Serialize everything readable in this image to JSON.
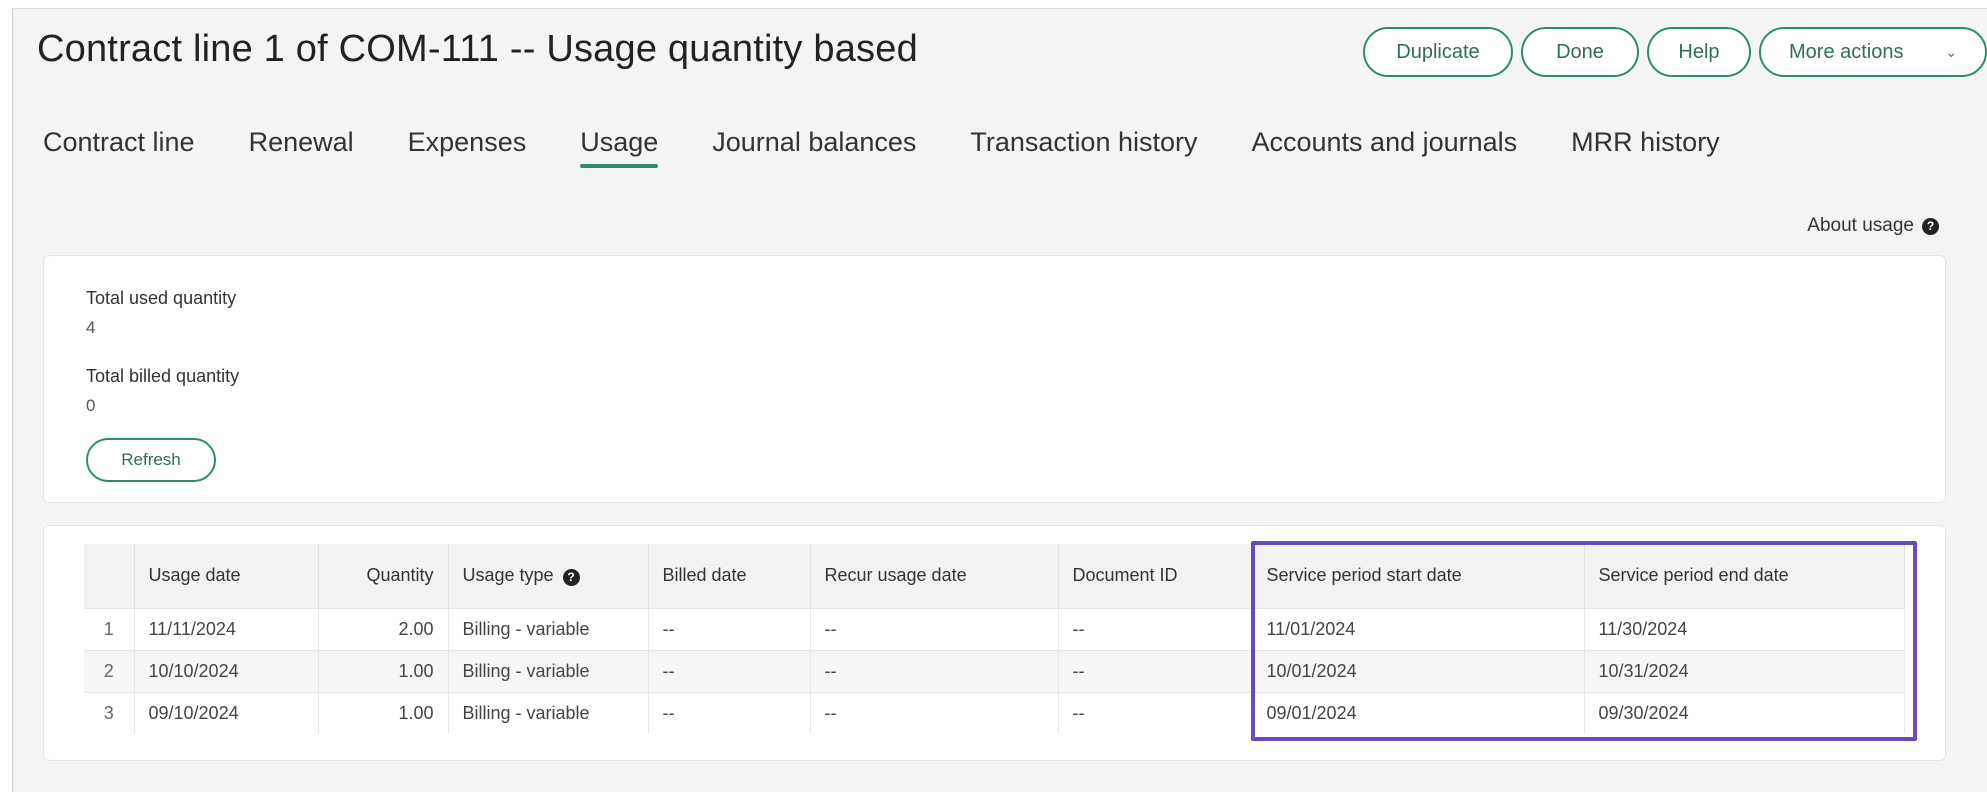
{
  "page": {
    "title": "Contract line 1 of COM-111 -- Usage quantity based"
  },
  "actions": {
    "duplicate": "Duplicate",
    "done": "Done",
    "help": "Help",
    "more": "More actions",
    "more_chevron": "⌄"
  },
  "tabs": [
    "Contract line",
    "Renewal",
    "Expenses",
    "Usage",
    "Journal balances",
    "Transaction history",
    "Accounts and journals",
    "MRR history"
  ],
  "active_tab": "Usage",
  "about_usage": "About usage",
  "help_glyph": "?",
  "summary": {
    "total_used_label": "Total used quantity",
    "total_used_value": "4",
    "total_billed_label": "Total billed quantity",
    "total_billed_value": "0",
    "refresh_label": "Refresh"
  },
  "table": {
    "columns": [
      "",
      "Usage date",
      "Quantity",
      "Usage type",
      "Billed date",
      "Recur usage date",
      "Document ID",
      "Service period start date",
      "Service period end date"
    ],
    "rows": [
      [
        "1",
        "11/11/2024",
        "2.00",
        "Billing - variable",
        "--",
        "--",
        "--",
        "11/01/2024",
        "11/30/2024"
      ],
      [
        "2",
        "10/10/2024",
        "1.00",
        "Billing - variable",
        "--",
        "--",
        "--",
        "10/01/2024",
        "10/31/2024"
      ],
      [
        "3",
        "09/10/2024",
        "1.00",
        "Billing - variable",
        "--",
        "--",
        "--",
        "09/01/2024",
        "09/30/2024"
      ]
    ]
  },
  "colors": {
    "accent": "#2e8b6e",
    "highlight": "#6a4bbf"
  }
}
